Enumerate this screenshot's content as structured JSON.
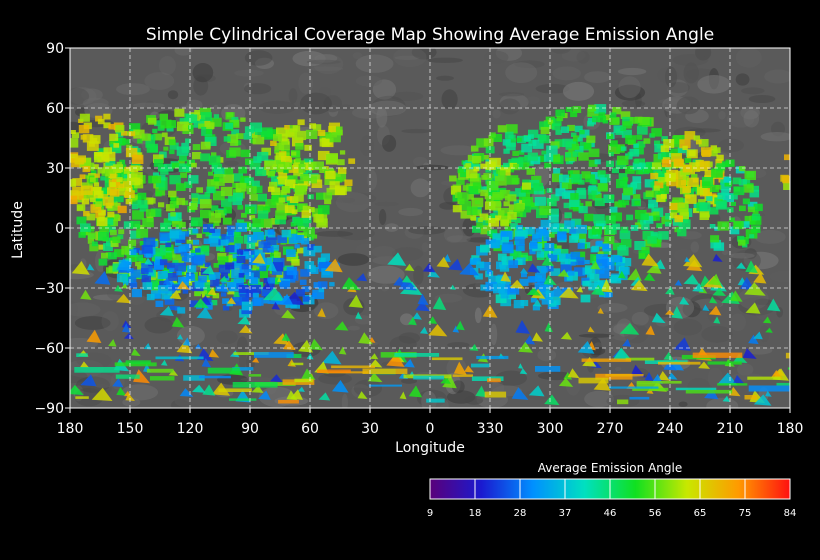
{
  "title": "Simple Cylindrical Coverage Map Showing Average Emission Angle",
  "map": {
    "projection": "simple cylindrical",
    "xlabel": "Longitude",
    "ylabel": "Latitude",
    "lon_ticks": [
      "180",
      "150",
      "120",
      "90",
      "60",
      "30",
      "0",
      "330",
      "300",
      "270",
      "240",
      "210",
      "180"
    ],
    "lat_ticks": [
      "90",
      "60",
      "30",
      "0",
      "−30",
      "−60",
      "−90"
    ],
    "lon_range": [
      180,
      -180
    ],
    "lat_range": [
      -90,
      90
    ],
    "grid": true,
    "grid_color": "#ffffff",
    "background_color": "#000000",
    "basemap_color": "#5a5a5a"
  },
  "colorbar": {
    "title": "Average Emission Angle",
    "ticks": [
      "9",
      "18",
      "28",
      "37",
      "46",
      "56",
      "65",
      "75",
      "84"
    ],
    "range": [
      9,
      84
    ],
    "colors": [
      "#5a007a",
      "#1a1ad0",
      "#0090ff",
      "#00e0c0",
      "#10e020",
      "#c8e800",
      "#ff9a00",
      "#ff1010"
    ],
    "placement": "bottom-right"
  }
}
